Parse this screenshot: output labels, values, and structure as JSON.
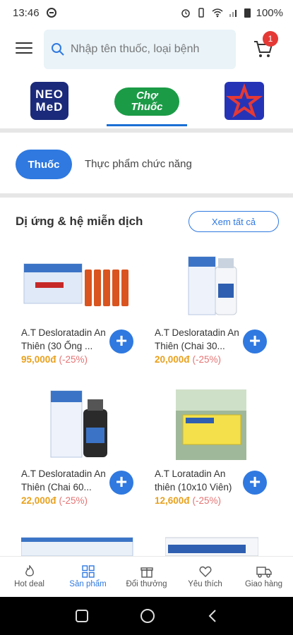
{
  "status_bar": {
    "time": "13:46",
    "battery": "100%"
  },
  "header": {
    "search_placeholder": "Nhập tên thuốc, loại bệnh",
    "cart_count": "1"
  },
  "brands": {
    "neomed_line1": "NEO",
    "neomed_line2": "MeD",
    "chothuoc_line1": "Chợ",
    "chothuoc_line2": "Thuốc"
  },
  "category_tabs": [
    {
      "label": "Thuốc",
      "active": true
    },
    {
      "label": "Thực phẩm chức năng",
      "active": false
    }
  ],
  "section": {
    "title": "Dị ứng & hệ miễn dịch",
    "see_all": "Xem tất cả"
  },
  "products": [
    {
      "name": "A.T Desloratadin An Thiên (30 Ống ...",
      "price": "95,000đ",
      "discount": "(-25%)"
    },
    {
      "name": "A.T Desloratadin An Thiên (Chai 30...",
      "price": "20,000đ",
      "discount": "(-25%)"
    },
    {
      "name": "A.T Desloratadin An Thiên (Chai 60...",
      "price": "22,000đ",
      "discount": "(-25%)"
    },
    {
      "name": "A.T Loratadin An thiên (10x10 Viên)",
      "price": "12,600đ",
      "discount": "(-25%)"
    }
  ],
  "bottom_nav": [
    {
      "label": "Hot deal",
      "icon": "flame-icon",
      "active": false
    },
    {
      "label": "Sản phẩm",
      "icon": "grid-icon",
      "active": true
    },
    {
      "label": "Đổi thưởng",
      "icon": "gift-icon",
      "active": false
    },
    {
      "label": "Yêu thích",
      "icon": "heart-icon",
      "active": false
    },
    {
      "label": "Giao hàng",
      "icon": "truck-icon",
      "active": false
    }
  ],
  "colors": {
    "accent": "#2f79e0",
    "price": "#e8a11d",
    "discount": "#e57373",
    "badge": "#e53935"
  }
}
